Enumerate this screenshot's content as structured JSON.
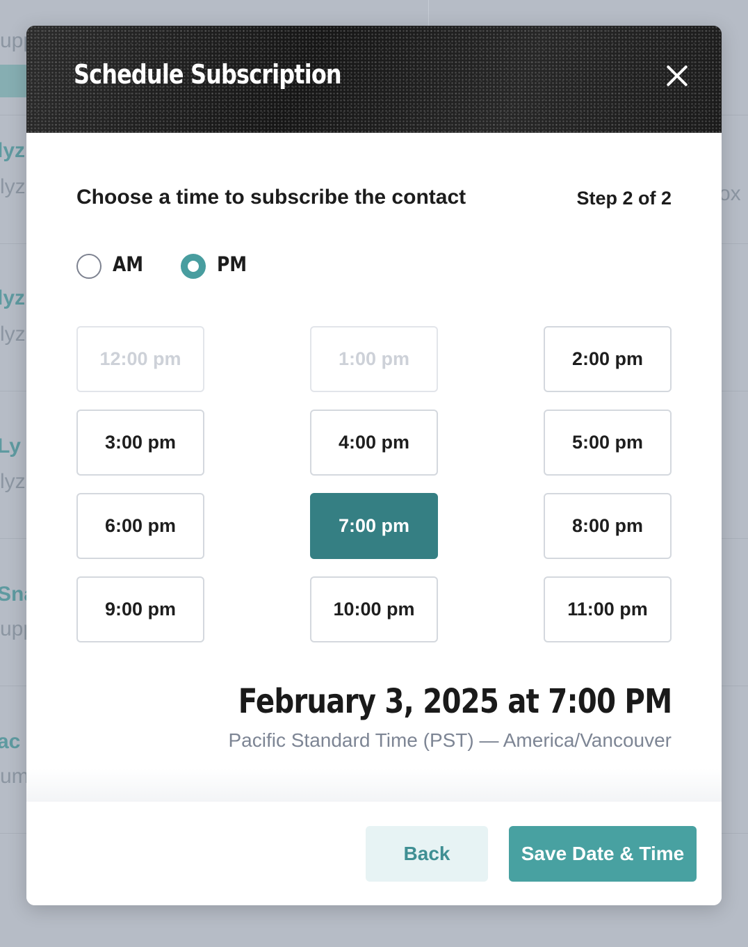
{
  "background": {
    "fragments": [
      "upp",
      "lyz",
      "lyza",
      "lyz",
      "lyza",
      "Ly",
      "lyza",
      "Sna",
      "upp",
      "ac",
      "um",
      "ox"
    ]
  },
  "modal": {
    "title": "Schedule Subscription",
    "subtitle": "Choose a time to subscribe the contact",
    "step": "Step 2 of 2",
    "period_options": [
      {
        "label": "AM",
        "checked": false
      },
      {
        "label": "PM",
        "checked": true
      }
    ],
    "time_slots": [
      {
        "label": "12:00 pm",
        "state": "disabled"
      },
      {
        "label": "1:00 pm",
        "state": "disabled"
      },
      {
        "label": "2:00 pm",
        "state": "available"
      },
      {
        "label": "3:00 pm",
        "state": "available"
      },
      {
        "label": "4:00 pm",
        "state": "available"
      },
      {
        "label": "5:00 pm",
        "state": "available"
      },
      {
        "label": "6:00 pm",
        "state": "available"
      },
      {
        "label": "7:00 pm",
        "state": "selected"
      },
      {
        "label": "8:00 pm",
        "state": "available"
      },
      {
        "label": "9:00 pm",
        "state": "available"
      },
      {
        "label": "10:00 pm",
        "state": "available"
      },
      {
        "label": "11:00 pm",
        "state": "available"
      }
    ],
    "selected_datetime": "February 3, 2025 at 7:00 PM",
    "timezone": "Pacific Standard Time (PST) — America/Vancouver",
    "back_label": "Back",
    "save_label": "Save Date & Time"
  },
  "colors": {
    "accent": "#489d9f",
    "selected_slot": "#357f83",
    "header_bg": "#1f1f1f",
    "overlay": "#b6bcc6"
  }
}
